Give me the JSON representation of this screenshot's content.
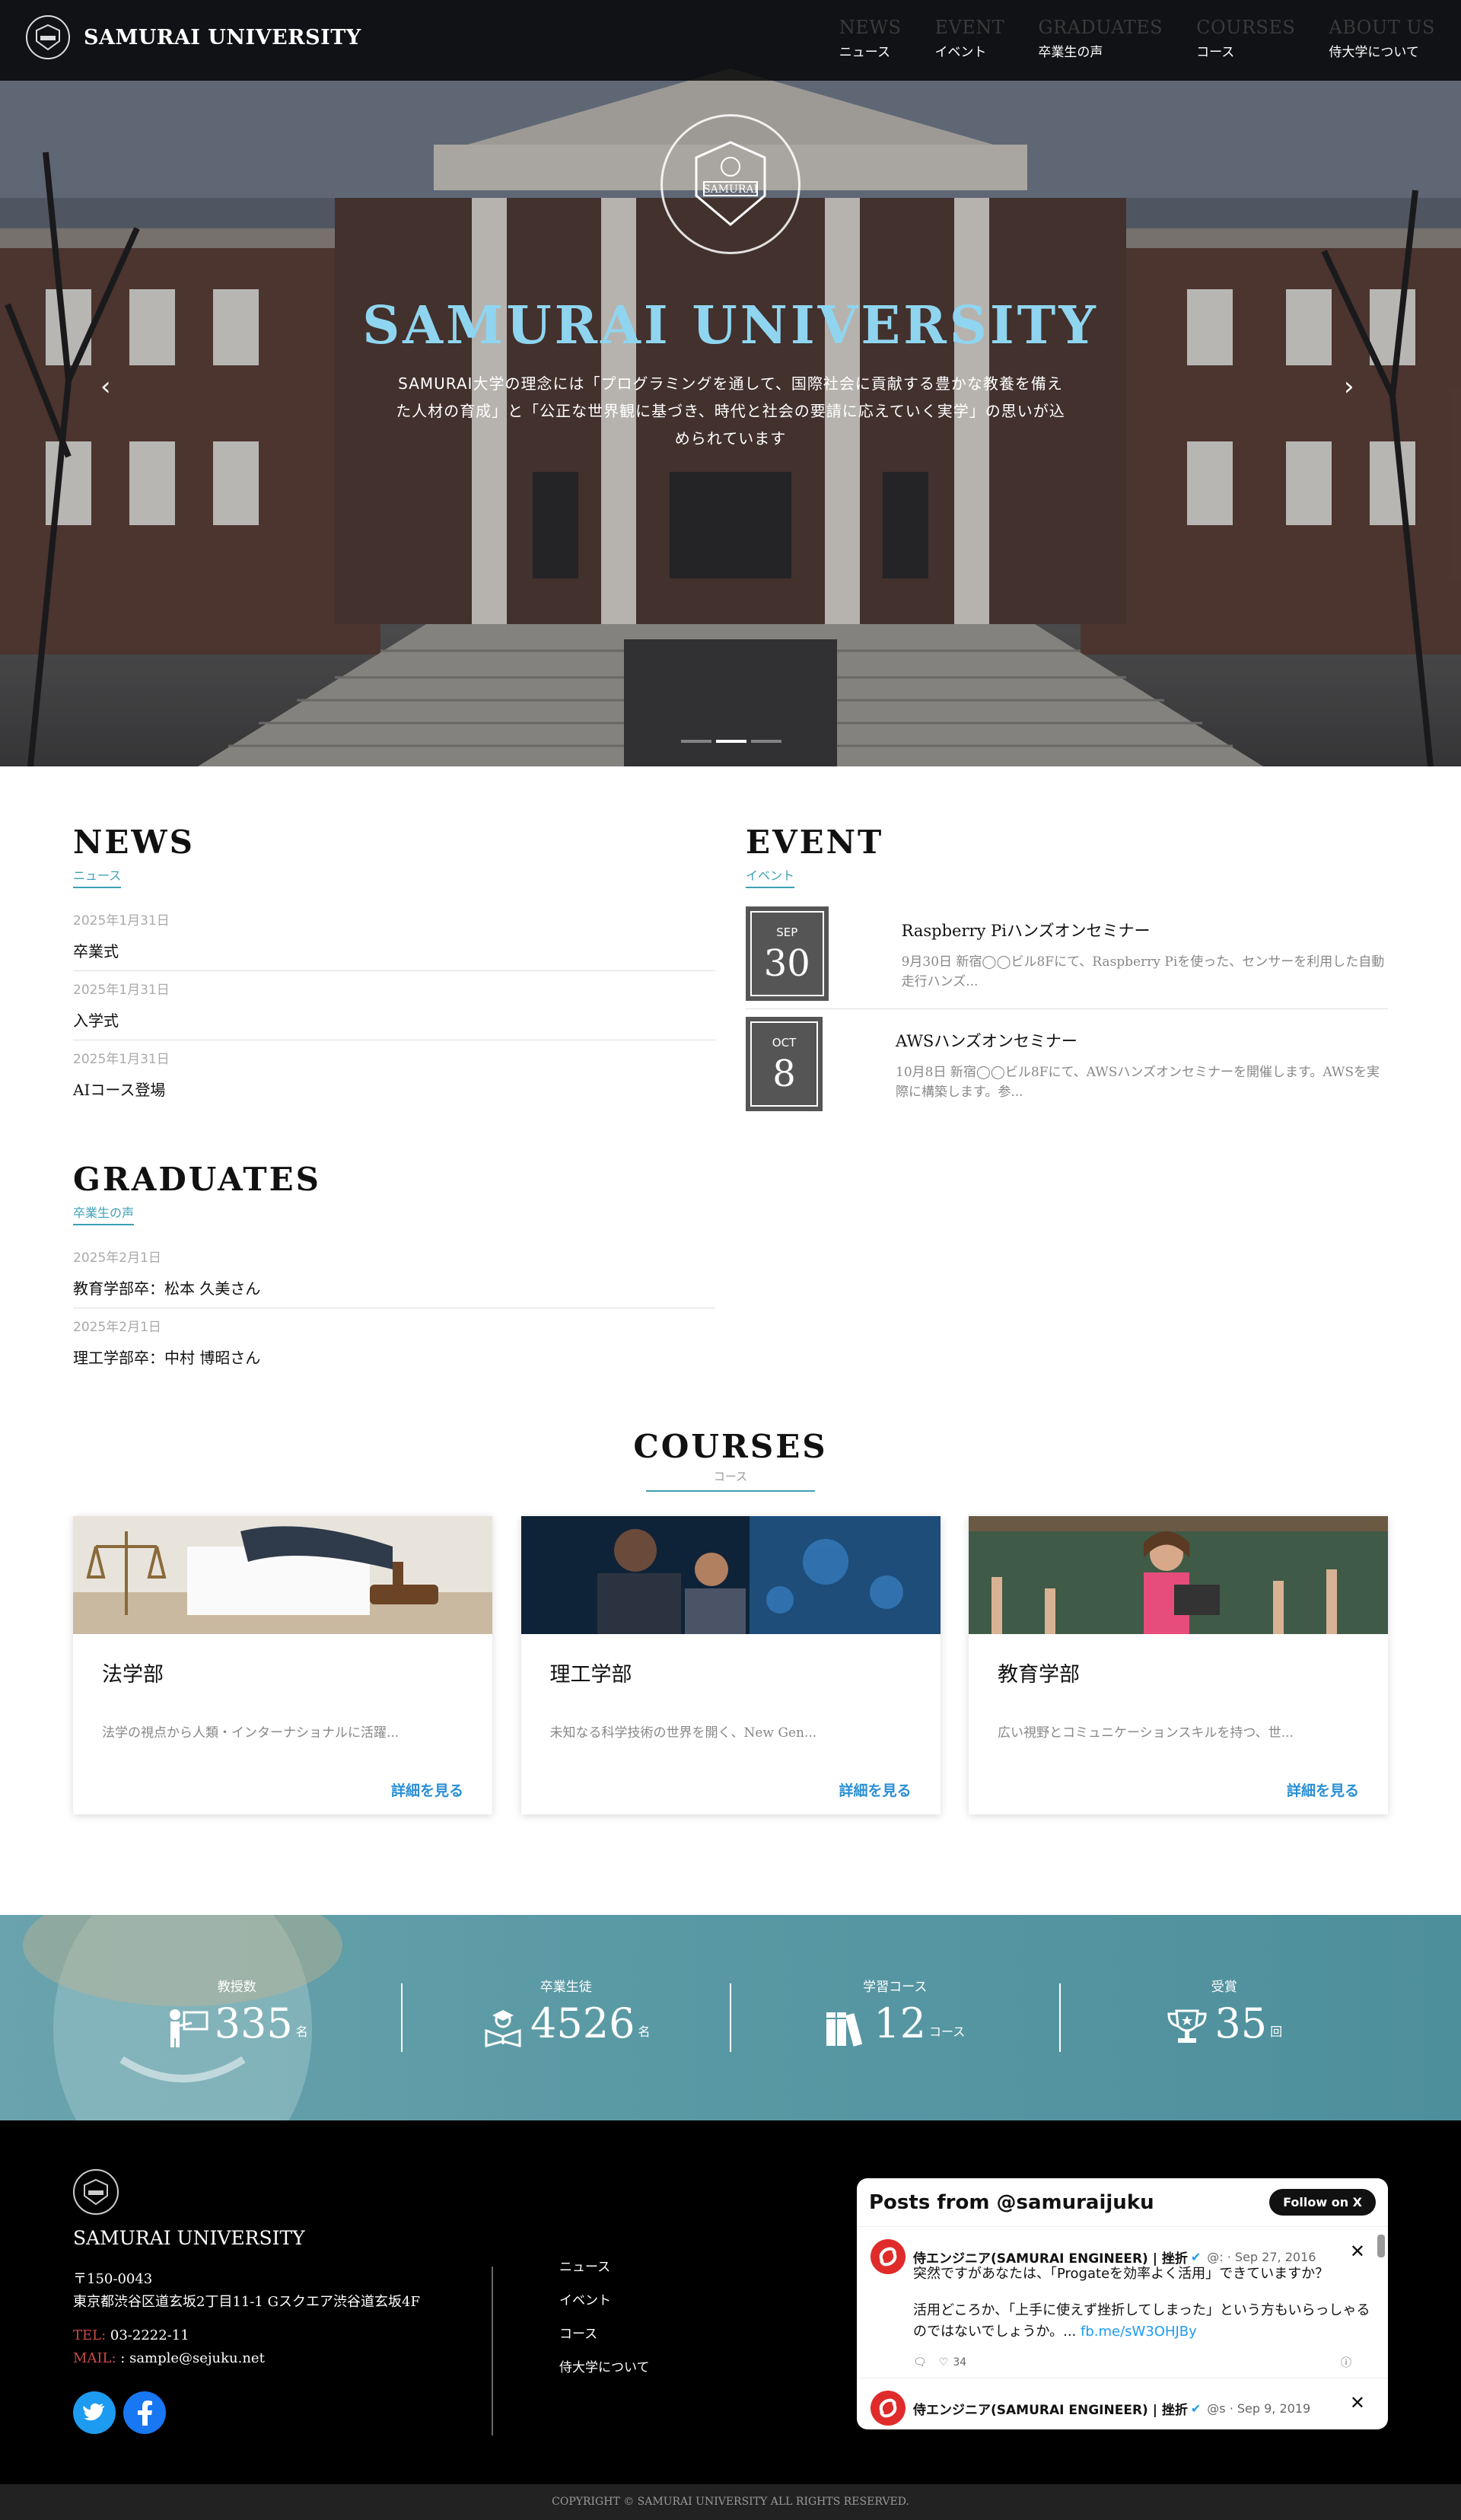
{
  "header": {
    "site_name": "SAMURAI UNIVERSITY",
    "nav": [
      {
        "en": "NEWS",
        "ja": "ニュース"
      },
      {
        "en": "EVENT",
        "ja": "イベント"
      },
      {
        "en": "GRADUATES",
        "ja": "卒業生の声"
      },
      {
        "en": "COURSES",
        "ja": "コース"
      },
      {
        "en": "ABOUT US",
        "ja": "侍大学について"
      }
    ]
  },
  "hero": {
    "title": "SAMURAI UNIVERSITY",
    "description": "SAMURAI大学の理念には「プログラミングを通して、国際社会に貢献する豊かな教養を備えた人材の育成」と「公正な世界観に基づき、時代と社会の要請に応えていく実学」の思いが込められています",
    "emblem_text": "SAMURAI",
    "prev_icon": "chevron-left-icon",
    "next_icon": "chevron-right-icon"
  },
  "news": {
    "title": "NEWS",
    "subtitle": "ニュース",
    "items": [
      {
        "date": "2025年1月31日",
        "title": "卒業式"
      },
      {
        "date": "2025年1月31日",
        "title": "入学式"
      },
      {
        "date": "2025年1月31日",
        "title": "AIコース登場"
      }
    ]
  },
  "event": {
    "title": "EVENT",
    "subtitle": "イベント",
    "items": [
      {
        "month": "SEP",
        "day": "30",
        "title": "Raspberry Piハンズオンセミナー",
        "text": "9月30日 新宿◯◯ビル8Fにて、Raspberry Piを使った、センサーを利用した自動走行ハンズ..."
      },
      {
        "month": "OCT",
        "day": "8",
        "title": "AWSハンズオンセミナー",
        "text": "10月8日 新宿◯◯ビル8Fにて、AWSハンズオンセミナーを開催します。AWSを実際に構築します。参..."
      }
    ]
  },
  "graduates": {
    "title": "GRADUATES",
    "subtitle": "卒業生の声",
    "items": [
      {
        "date": "2025年2月1日",
        "title": "教育学部卒：松本 久美さん"
      },
      {
        "date": "2025年2月1日",
        "title": "理工学部卒：中村 博昭さん"
      }
    ]
  },
  "courses": {
    "title": "COURSES",
    "subtitle": "コース",
    "link_label": "詳細を見る",
    "items": [
      {
        "title": "法学部",
        "text": "法学の視点から人類・インターナショナルに活躍..."
      },
      {
        "title": "理工学部",
        "text": "未知なる科学技術の世界を開く、New Gen..."
      },
      {
        "title": "教育学部",
        "text": "広い視野とコミュニケーションスキルを持つ、世..."
      }
    ]
  },
  "stats": [
    {
      "label": "教授数",
      "value": "335",
      "unit": "名",
      "icon": "teacher-icon"
    },
    {
      "label": "卒業生徒",
      "value": "4526",
      "unit": "名",
      "icon": "graduate-icon"
    },
    {
      "label": "学習コース",
      "value": "12",
      "unit": "コース",
      "icon": "books-icon"
    },
    {
      "label": "受賞",
      "value": "35",
      "unit": "回",
      "icon": "trophy-icon"
    }
  ],
  "footer": {
    "site_name": "SAMURAI UNIVERSITY",
    "postal": "〒150-0043",
    "address": "東京都渋谷区道玄坂2丁目11-1 Gスクエア渋谷道玄坂4F",
    "tel_label": "TEL:",
    "tel": "03-2222-11",
    "mail_label": "MAIL:",
    "mail": ": sample@sejuku.net",
    "links": [
      "ニュース",
      "イベント",
      "コース",
      "侍大学について"
    ],
    "copyright": "COPYRIGHT © SAMURAI UNIVERSITY ALL RIGHTS RESERVED."
  },
  "x_widget": {
    "title": "Posts from @samuraijuku",
    "follow_label": "Follow on X",
    "posts": [
      {
        "name": "侍エンジニア(SAMURAI ENGINEER) | 挫折",
        "meta": "@: · Sep 27, 2016",
        "line1": "突然ですがあなたは、「Progateを効率よく活用」できていますか？",
        "line2": "活用どころか、「上手に使えず挫折してしまった」という方もいらっしゃるのではないでしょうか。...",
        "link": "fb.me/sW3OHJBy",
        "likes": "34"
      },
      {
        "name": "侍エンジニア(SAMURAI ENGINEER) | 挫折",
        "meta": "@s · Sep 9, 2019"
      }
    ]
  },
  "colors": {
    "accent": "#3ea0b5",
    "hero_title": "#8fd5f0",
    "link": "#2a8fd6",
    "stats_bg": "#5a9aa5"
  }
}
